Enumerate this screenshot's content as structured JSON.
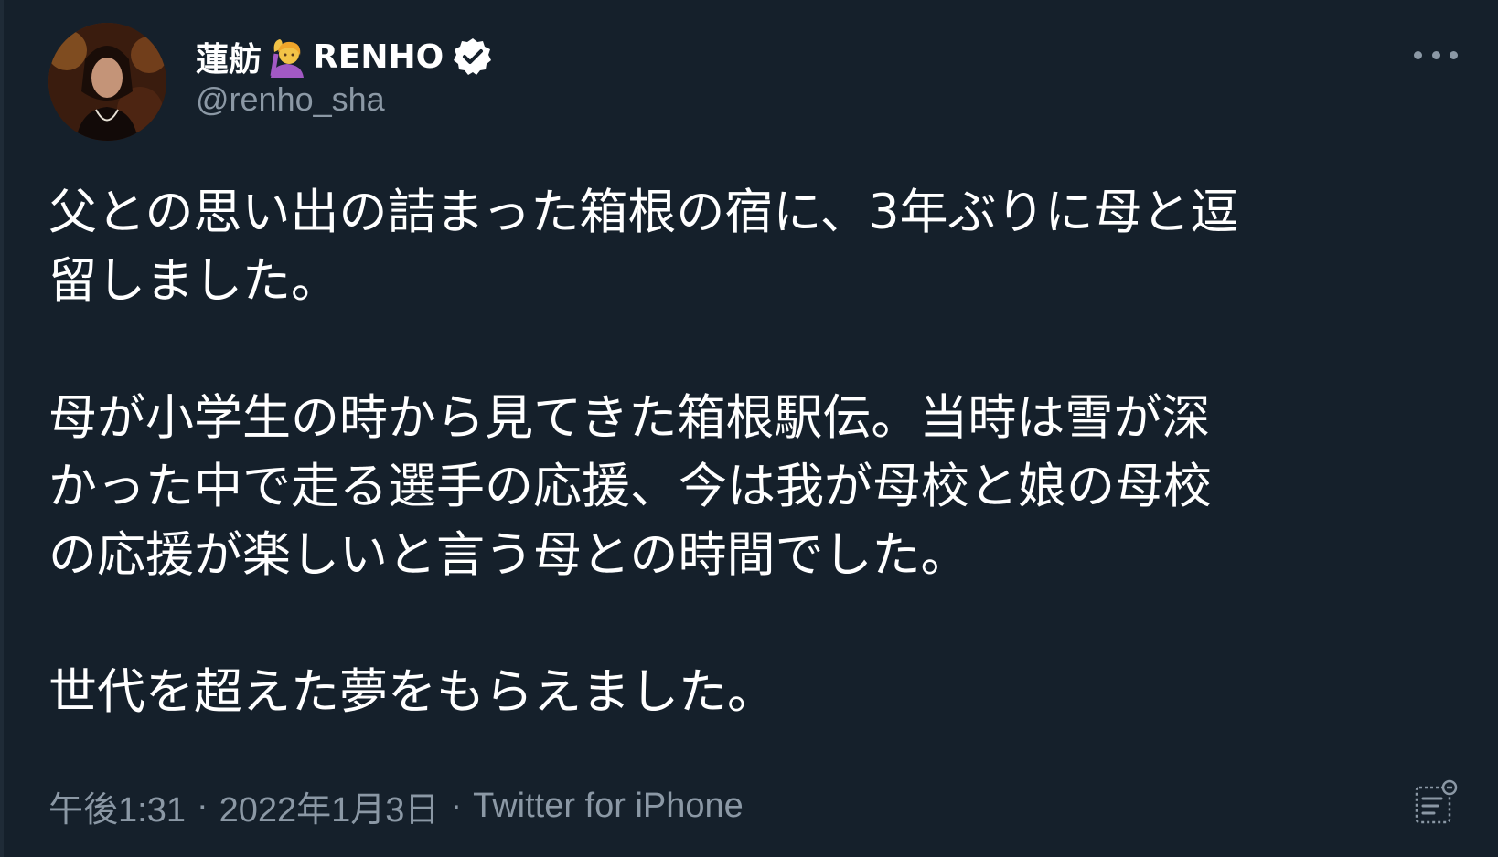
{
  "author": {
    "display_name": "蓮舫",
    "display_name_suffix": "RENHO",
    "handle": "@renho_sha",
    "emoji_icon": "woman-raising-hand-icon",
    "verified_icon": "verified-badge-icon"
  },
  "tweet": {
    "paragraphs": [
      "父との思い出の詰まった箱根の宿に、3年ぶりに母と逗\n留しました。",
      "母が小学生の時から見てきた箱根駅伝。当時は雪が深\nかった中で走る選手の応援、今は我が母校と娘の母校\nの応援が楽しいと言う母との時間でした。",
      "世代を超えた夢をもらえました。"
    ]
  },
  "meta": {
    "time": "午後1:31",
    "date": "2022年1月3日",
    "separator": "·",
    "source": "Twitter for iPhone"
  },
  "icons": {
    "more": "more-options-icon",
    "analytics": "tweet-analytics-icon"
  },
  "colors": {
    "background": "#15202b",
    "primary_text": "#ffffff",
    "secondary_text": "#8b98a5"
  }
}
